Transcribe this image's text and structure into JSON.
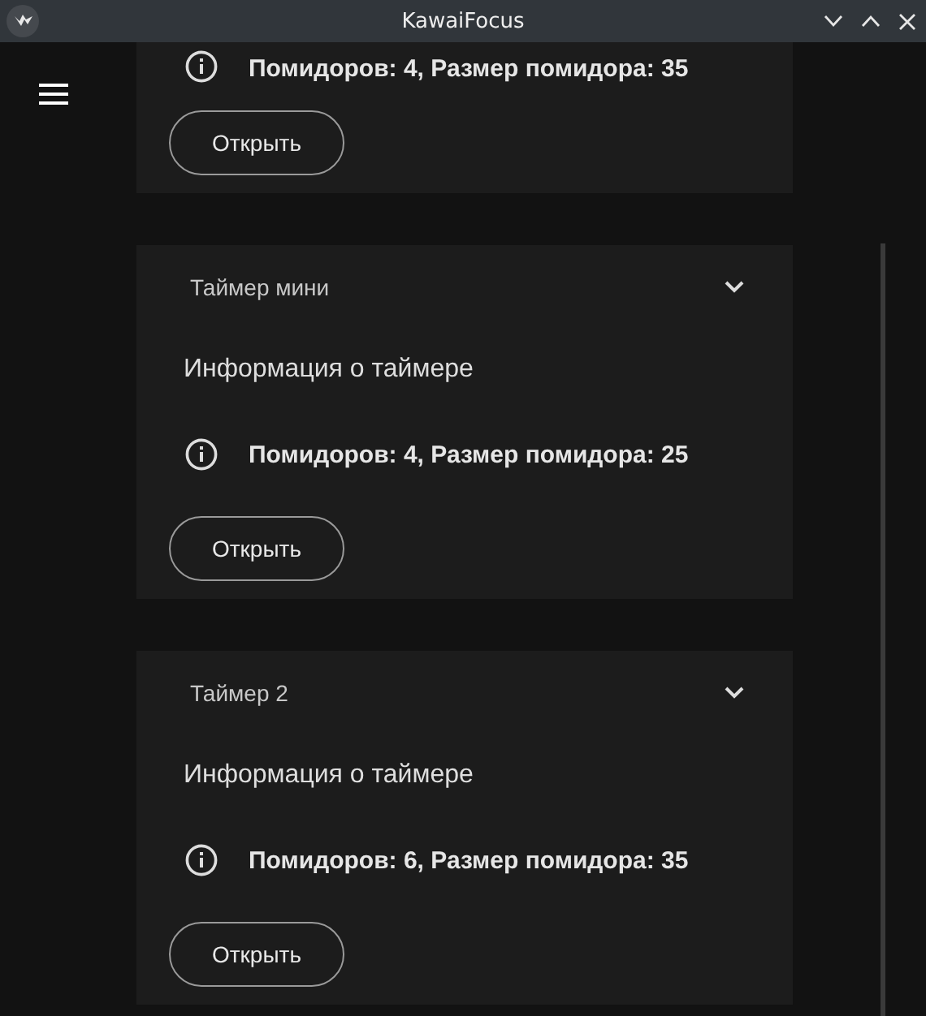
{
  "window": {
    "title": "KawaiFocus"
  },
  "cards": [
    {
      "info": "Помидоров: 4, Размер помидора: 35",
      "button": "Открыть"
    },
    {
      "title": "Таймер мини",
      "heading": "Информация о таймере",
      "info": "Помидоров: 4, Размер помидора: 25",
      "button": "Открыть"
    },
    {
      "title": "Таймер 2",
      "heading": "Информация о таймере",
      "info": "Помидоров: 6, Размер помидора: 35",
      "button": "Открыть"
    }
  ]
}
